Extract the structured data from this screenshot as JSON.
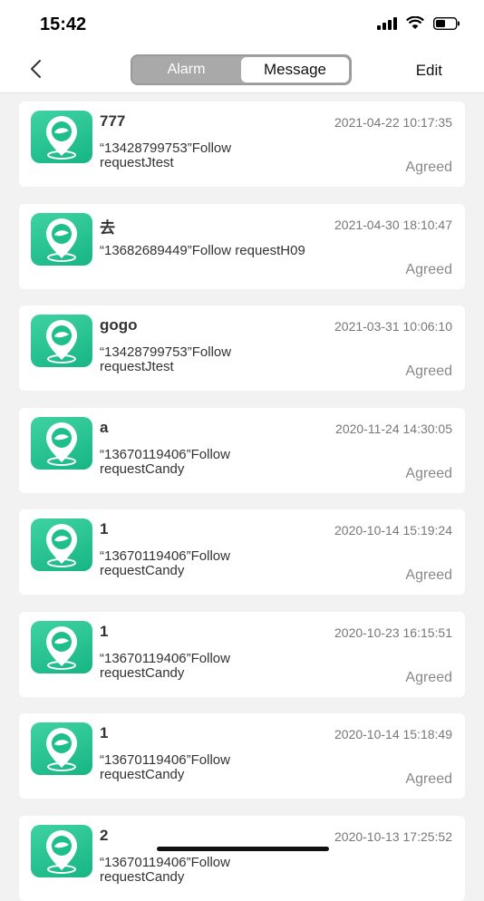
{
  "status_bar": {
    "time": "15:42"
  },
  "nav": {
    "tabs": [
      "Alarm",
      "Message"
    ],
    "active_tab": "Message",
    "edit_label": "Edit"
  },
  "messages": [
    {
      "name": "777",
      "date": "2021-04-22 10:17:35",
      "message": "“13428799753”Follow requestJtest",
      "status": "Agreed"
    },
    {
      "name": "去",
      "date": "2021-04-30 18:10:47",
      "message": "“13682689449”Follow requestH09",
      "status": "Agreed"
    },
    {
      "name": "gogo",
      "date": "2021-03-31 10:06:10",
      "message": "“13428799753”Follow requestJtest",
      "status": "Agreed"
    },
    {
      "name": "a",
      "date": "2020-11-24 14:30:05",
      "message": "“13670119406”Follow requestCandy",
      "status": "Agreed"
    },
    {
      "name": "1",
      "date": "2020-10-14 15:19:24",
      "message": "“13670119406”Follow requestCandy",
      "status": "Agreed"
    },
    {
      "name": "1",
      "date": "2020-10-23 16:15:51",
      "message": "“13670119406”Follow requestCandy",
      "status": "Agreed"
    },
    {
      "name": "1",
      "date": "2020-10-14 15:18:49",
      "message": "“13670119406”Follow requestCandy",
      "status": "Agreed"
    },
    {
      "name": "2",
      "date": "2020-10-13 17:25:52",
      "message": "“13670119406”Follow requestCandy",
      "status": ""
    }
  ],
  "icons": {
    "back": "chevron-left-icon",
    "app_logo": "location-pin-icon"
  },
  "colors": {
    "logo_green": "#1fbf8c",
    "background": "#f2f2f2"
  }
}
